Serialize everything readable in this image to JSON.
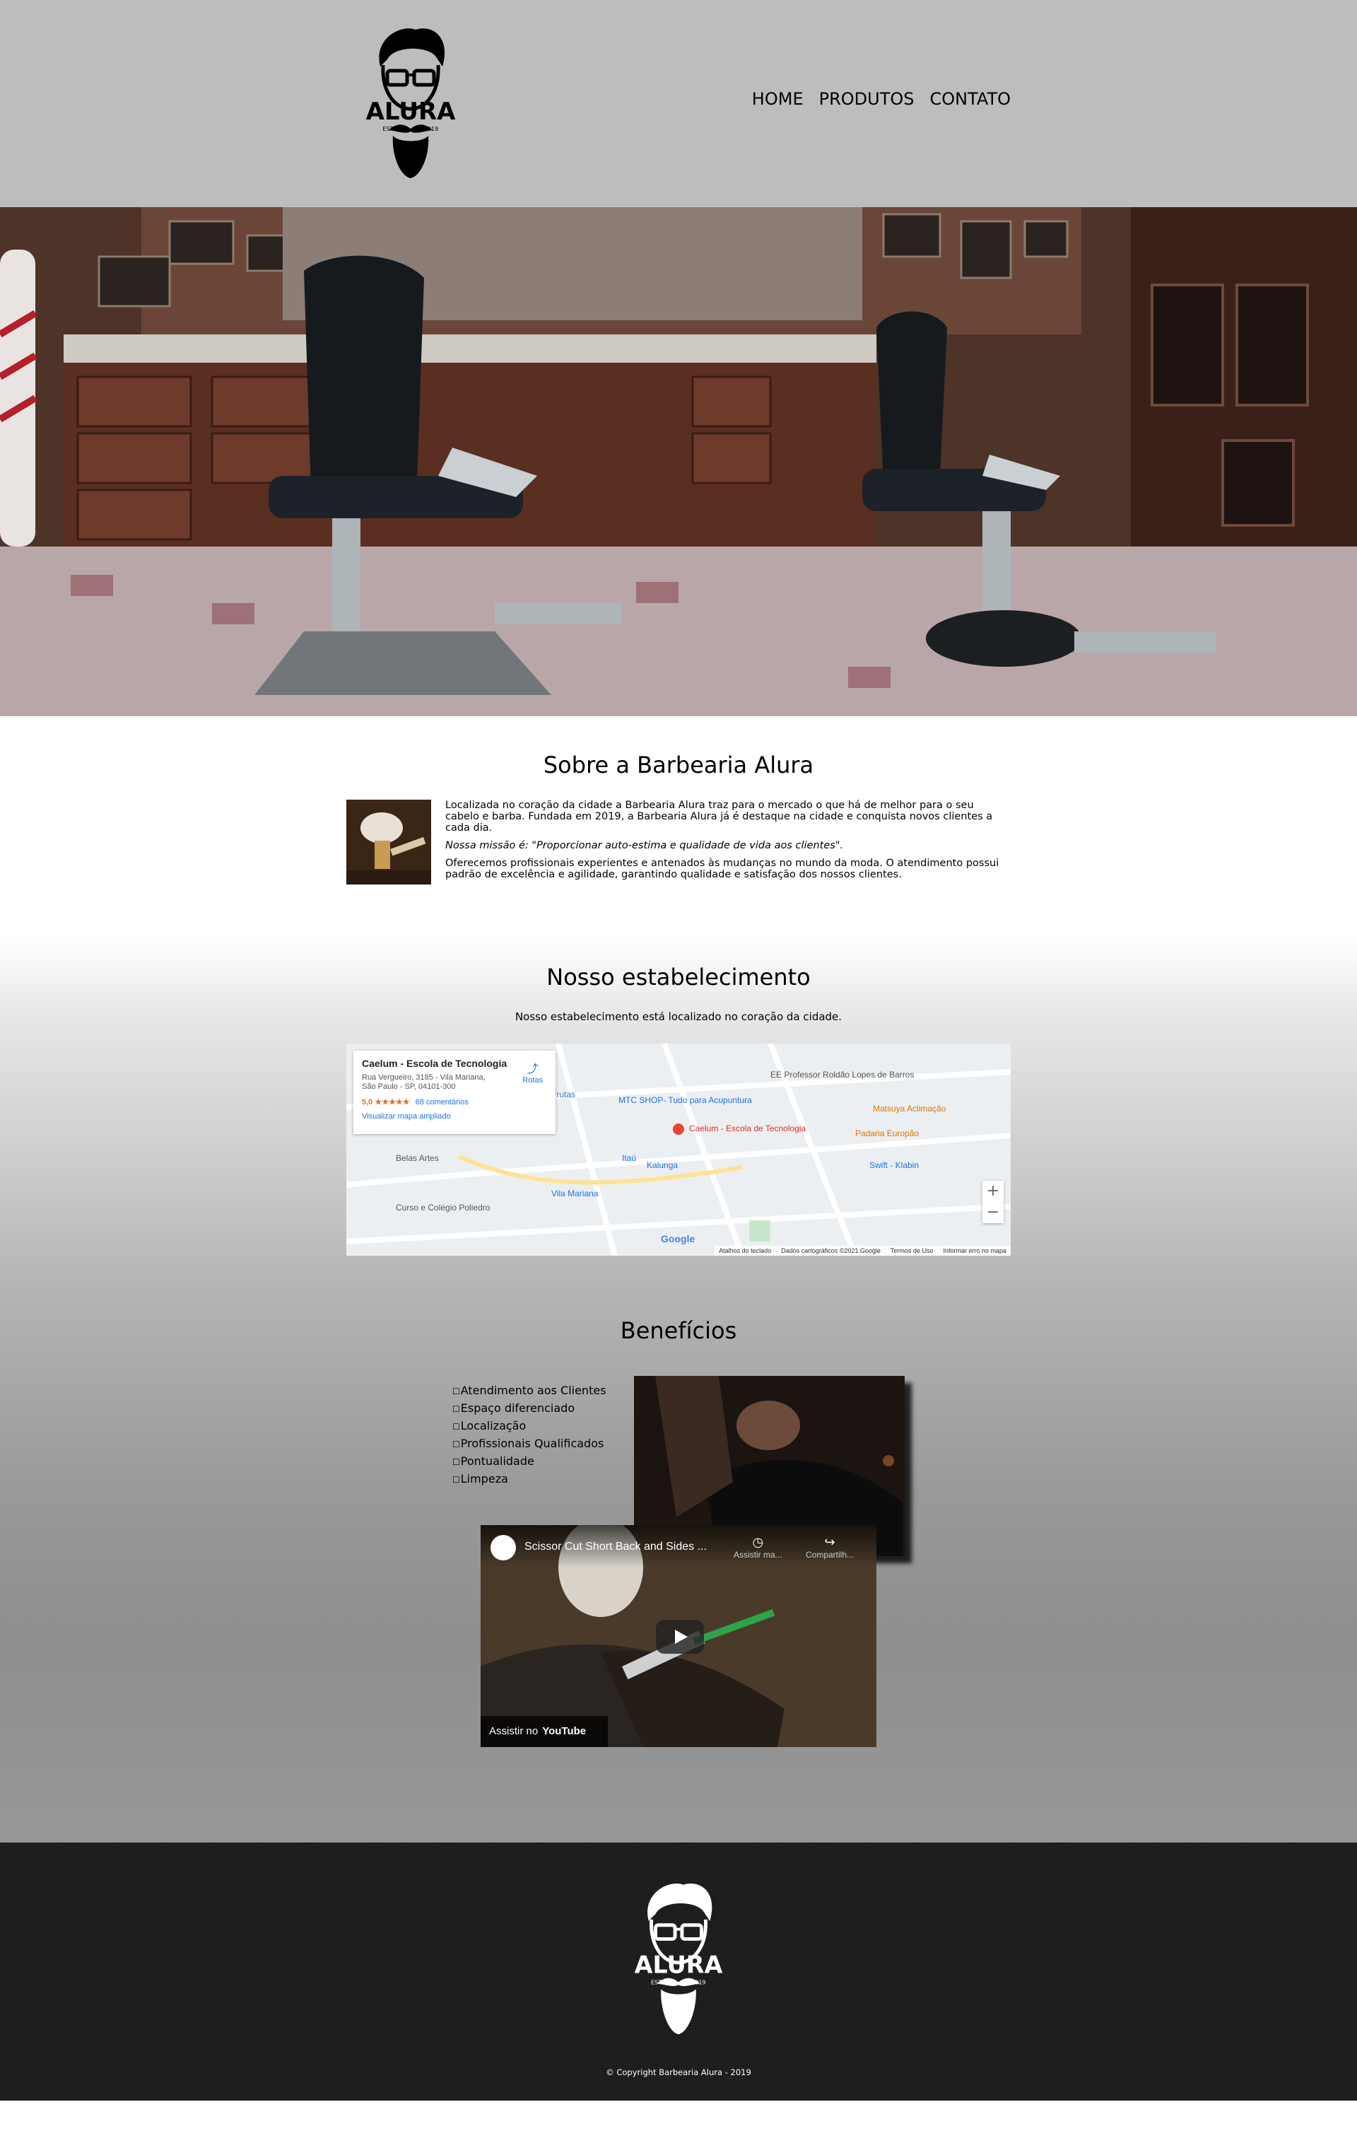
{
  "header": {
    "logo": {
      "wordmark": "ALURA",
      "est_left": "ESTD",
      "est_right": "2019"
    },
    "nav": [
      "HOME",
      "PRODUTOS",
      "CONTATO"
    ]
  },
  "banner": {
    "image": "barbershop-interior-photo"
  },
  "sobre": {
    "title": "Sobre a Barbearia Alura",
    "p1": "Localizada no coração da cidade a Barbearia Alura traz para o mercado o que há de melhor para o seu cabelo e barba. Fundada em 2019, a Barbearia Alura já é destaque na cidade e conquista novos clientes a cada dia.",
    "p2": "Nossa missão é: \"Proporcionar auto-estima e qualidade de vida aos clientes\".",
    "p3": "Oferecemos profissionais experientes e antenados às mudanças no mundo da moda. O atendimento possui padrão de excelência e agilidade, garantindo qualidade e satisfação dos nossos clientes."
  },
  "estabelecimento": {
    "title": "Nosso estabelecimento",
    "subtitle": "Nosso estabelecimento está localizado no coração da cidade.",
    "map": {
      "place_name": "Caelum - Escola de Tecnologia",
      "address": "Rua Vergueiro, 3185 - Vila Mariana, São Paulo - SP, 04101-300",
      "rating": "5,0 ★★★★★",
      "reviews": "68 comentários",
      "view_larger": "Visualizar mapa ampliado",
      "directions": "Rotas",
      "labels": [
        "EE Professor Roldão Lopes de Barros",
        "MTC SHOP- Tudo para Acupuntura",
        "Caelum - Escola de Tecnologia",
        "Matsuya Aclimação",
        "Padaria Europão",
        "Swift - Klabin",
        "Kalunga",
        "Vila Mariana",
        "Curso e Colégio Poliedro",
        "Belas Artes",
        "Frutas",
        "Itaú"
      ],
      "zoom_in": "+",
      "zoom_out": "−",
      "footer": [
        "Atalhos do teclado",
        "Dados cartográficos ©2021 Google",
        "Termos de Uso",
        "Informar erro no mapa"
      ],
      "google": "Google"
    }
  },
  "beneficios": {
    "title": "Benefícios",
    "items": [
      "Atendimento aos Clientes",
      "Espaço diferenciado",
      "Localização",
      "Profissionais Qualificados",
      "Pontualidade",
      "Limpeza"
    ],
    "video": {
      "title": "Scissor Cut Short Back and Sides ...",
      "watch_later": "Assistir ma...",
      "share": "Compartilh...",
      "watch_on": "Assistir no",
      "platform": "YouTube"
    }
  },
  "footer": {
    "logo": {
      "wordmark": "ALURA",
      "est_left": "ESTD",
      "est_right": "2019"
    },
    "copyright": "© Copyright Barbearia Alura - 2019"
  }
}
